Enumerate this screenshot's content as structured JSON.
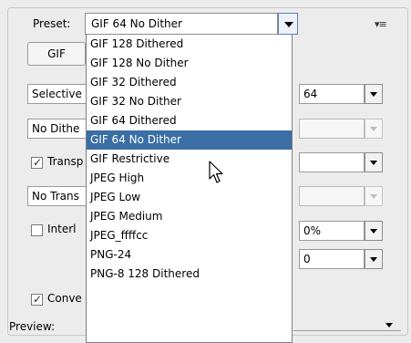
{
  "preset": {
    "label": "Preset:",
    "value": "GIF 64 No Dither",
    "menu_icon": "panel-menu-icon"
  },
  "format_tab": {
    "label": "GIF"
  },
  "left_fields": {
    "reduction": "Selective",
    "dither": "No Dithe",
    "transparency_label": "Transp",
    "matte_dither": "No Trans",
    "interlaced_label": "Interl",
    "convert_label": "Conve"
  },
  "right_fields": {
    "colors": "64",
    "dither_amount": "",
    "matte": "",
    "amount": "",
    "lossy": "0%",
    "web_snap": "0"
  },
  "preview": {
    "label": "Preview:"
  },
  "dropdown": {
    "items": [
      "GIF 128 Dithered",
      "GIF 128 No Dither",
      "GIF 32 Dithered",
      "GIF 32 No Dither",
      "GIF 64 Dithered",
      "GIF 64 No Dither",
      "GIF Restrictive",
      "JPEG High",
      "JPEG Low",
      "JPEG Medium",
      "JPEG_ffffcc",
      "PNG-24",
      "PNG-8 128 Dithered"
    ],
    "selected_index": 5
  },
  "colors": {
    "selection": "#3a6ea5",
    "panel_bg": "#ececec"
  }
}
